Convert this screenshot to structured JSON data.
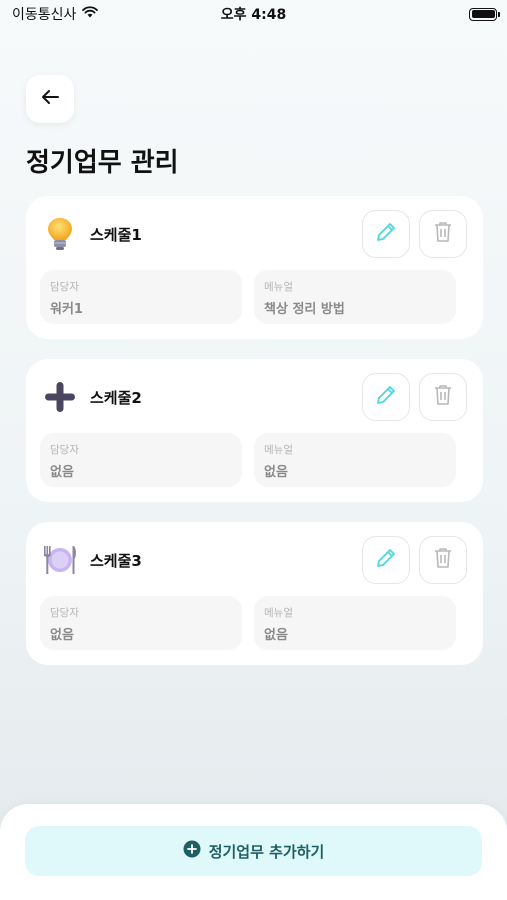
{
  "status_bar": {
    "carrier": "이동통신사",
    "time": "오후 4:48"
  },
  "header": {
    "title": "정기업무 관리"
  },
  "field_labels": {
    "assignee": "담당자",
    "manual": "메뉴얼"
  },
  "schedules": [
    {
      "name": "스케줄1",
      "icon": "lightbulb-icon",
      "assignee": "워커1",
      "manual": "책상 정리 방법"
    },
    {
      "name": "스케줄2",
      "icon": "plus-cross-icon",
      "assignee": "없음",
      "manual": "없음"
    },
    {
      "name": "스케줄3",
      "icon": "fork-knife-plate-icon",
      "assignee": "없음",
      "manual": "없음"
    }
  ],
  "footer": {
    "add_label": "정기업무 추가하기"
  },
  "colors": {
    "accent": "#4fd6dc",
    "add_bg": "#dff9fa",
    "add_text": "#1f5f63"
  }
}
